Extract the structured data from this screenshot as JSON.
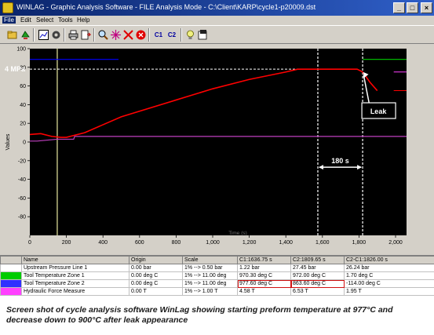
{
  "window": {
    "title": "WINLAG - Graphic Analysis Software - FILE Analysis Mode - C:\\Client\\KARP\\cycle1-p20009.dst",
    "controls": [
      "_",
      "□",
      "×"
    ]
  },
  "menu": [
    "File",
    "Edit",
    "Select",
    "Tools",
    "Help"
  ],
  "toolbar": {
    "icons": [
      "open-icon",
      "refresh-icon",
      "stats-icon",
      "settings-icon",
      "print-icon",
      "print-preview-icon",
      "zoom-icon",
      "cursor-cross-icon",
      "delete-cross-icon",
      "stop-icon",
      "lamp-icon",
      "export-icon"
    ],
    "c1_label": "C1",
    "c2_label": "C2"
  },
  "chart_data": {
    "type": "line",
    "ylabel": "Values",
    "xlabel": "Time (s)",
    "ylim": [
      -100,
      100
    ],
    "xlim": [
      0,
      2060
    ],
    "y_ticks": [
      100,
      80,
      60,
      40,
      20,
      0,
      -20,
      -40,
      -60,
      -80
    ],
    "x_ticks": [
      0,
      200,
      400,
      600,
      800,
      1000,
      1200,
      1400,
      1600,
      1800,
      2000
    ],
    "series": [
      {
        "name": "Upstream Pressure Line 1",
        "color": "#0000ff",
        "x": [
          0,
          485
        ],
        "y": [
          88.5,
          88.5
        ]
      },
      {
        "name": "Tool Temperature Zone 1",
        "color": "#00cc00",
        "x": [
          1820,
          2060
        ],
        "y": [
          88.5,
          88.5
        ]
      },
      {
        "name": "Tool Temperature Zone 2",
        "color": "#ff0000",
        "x": [
          0,
          60,
          120,
          170,
          200,
          300,
          500,
          800,
          1000,
          1200,
          1400,
          1465,
          1575,
          1700,
          1740,
          1790,
          1820,
          1860,
          1900
        ],
        "y": [
          8,
          9,
          6,
          5,
          5,
          10,
          27,
          45,
          57,
          67,
          75,
          78,
          78,
          78,
          78,
          78,
          75,
          64,
          55
        ]
      },
      {
        "name": "Hydraulic Force Measure",
        "color": "#c040c0",
        "x": [
          0,
          40,
          150,
          240,
          245,
          600,
          2060
        ],
        "y": [
          1,
          1,
          3,
          3,
          6,
          6,
          6
        ]
      }
    ],
    "cursors": [
      {
        "x": 150,
        "color": "#e8e8a0"
      },
      {
        "x": 1575,
        "color": "#ffffff",
        "dashed": true
      },
      {
        "x": 1820,
        "color": "#ffffff",
        "dashed": true
      }
    ],
    "annotations": {
      "pressure_label": "4 MPa",
      "leak_label": "Leak",
      "interval_label": "180 s"
    }
  },
  "table": {
    "headers": [
      "",
      "Name",
      "Origin",
      "Scale",
      "C1:1636.75 s",
      "C2:1809.65 s",
      "C2-C1:1826.00 s"
    ],
    "rows": [
      {
        "color": "#ffffff",
        "name": "Upstream Pressure Line 1",
        "origin": "0.00 bar",
        "scale": "1% --> 0.50 bar",
        "c1": "1.22 bar",
        "c2": "27.45 bar",
        "diff": "26.24 bar"
      },
      {
        "color": "#00cc00",
        "name": "Tool Temperature Zone 1",
        "origin": "0.00 deg C",
        "scale": "1% --> 11.00 deg",
        "c1": "970.30 deg C",
        "c2": "972.00 deg C",
        "diff": "1.70 deg C"
      },
      {
        "color": "#3030ff",
        "name": "Tool Temperature Zone 2",
        "origin": "0.00 deg C",
        "scale": "1% --> 11.00 deg",
        "c1": "977.60 deg C",
        "c2": "863.60 deg C",
        "diff": "-114.00 deg C"
      },
      {
        "color": "#ff40ff",
        "name": "Hydraulic Force Measure",
        "origin": "0.00 T",
        "scale": "1% --> 1.00 T",
        "c1": "4.58 T",
        "c2": "6.53 T",
        "diff": "1.95 T"
      }
    ]
  },
  "caption": "Screen shot of cycle analysis software WinLag showing starting preform temperature at 977°C and decrease down to 900°C after leak appearance"
}
